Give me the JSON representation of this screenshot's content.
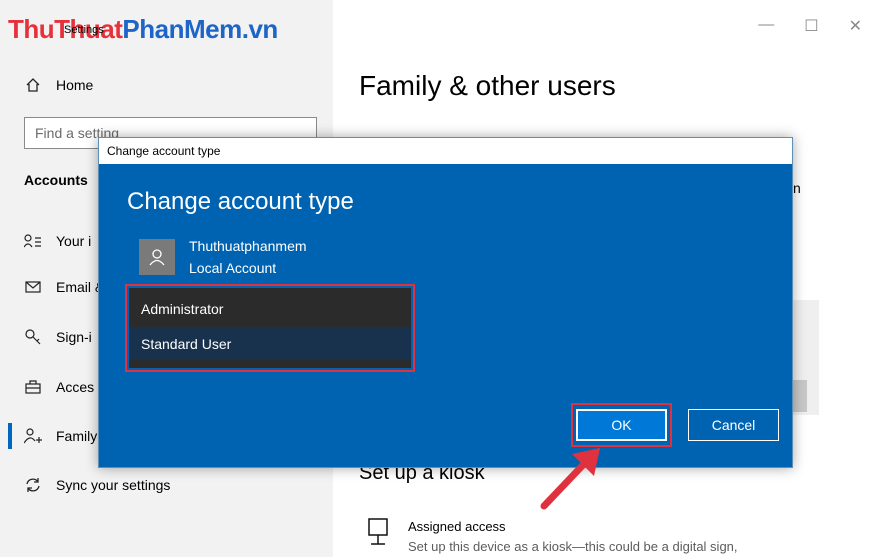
{
  "watermark": {
    "part1": "ThuThuat",
    "part2": "PhanMem.vn"
  },
  "window": {
    "title": "Settings",
    "controls": {
      "minimize": "—",
      "maximize": "☐",
      "close": "✕"
    }
  },
  "sidebar": {
    "home_label": "Home",
    "search_placeholder": "Find a setting",
    "section_title": "Accounts",
    "items": [
      {
        "label": "Your info",
        "icon": "person-card-icon"
      },
      {
        "label": "Email & accounts",
        "icon": "mail-icon"
      },
      {
        "label": "Sign-in options",
        "icon": "key-icon"
      },
      {
        "label": "Access work or school",
        "icon": "briefcase-icon"
      },
      {
        "label": "Family & other users",
        "icon": "add-person-icon"
      },
      {
        "label": "Sync your settings",
        "icon": "sync-icon"
      }
    ],
    "visible_item_labels": [
      "Your i",
      "Email &",
      "Sign-i",
      "Acces",
      "Family",
      "Sync your settings"
    ]
  },
  "main": {
    "page_title": "Family & other users",
    "bg_fragment": "n",
    "kiosk": {
      "title": "Set up a kiosk",
      "item_title": "Assigned access",
      "item_desc": "Set up this device as a kiosk—this could be a digital sign,"
    }
  },
  "dialog": {
    "titlebar": "Change account type",
    "heading": "Change account type",
    "account_name": "Thuthuatphanmem",
    "account_type": "Local Account",
    "options": [
      "Administrator",
      "Standard User"
    ],
    "selected_option": "Standard User",
    "ok_label": "OK",
    "cancel_label": "Cancel"
  },
  "colors": {
    "dialog_bg": "#0063b1",
    "ok_button": "#0078d7",
    "highlight_outline": "#e0323e",
    "accent": "#0067c0"
  }
}
